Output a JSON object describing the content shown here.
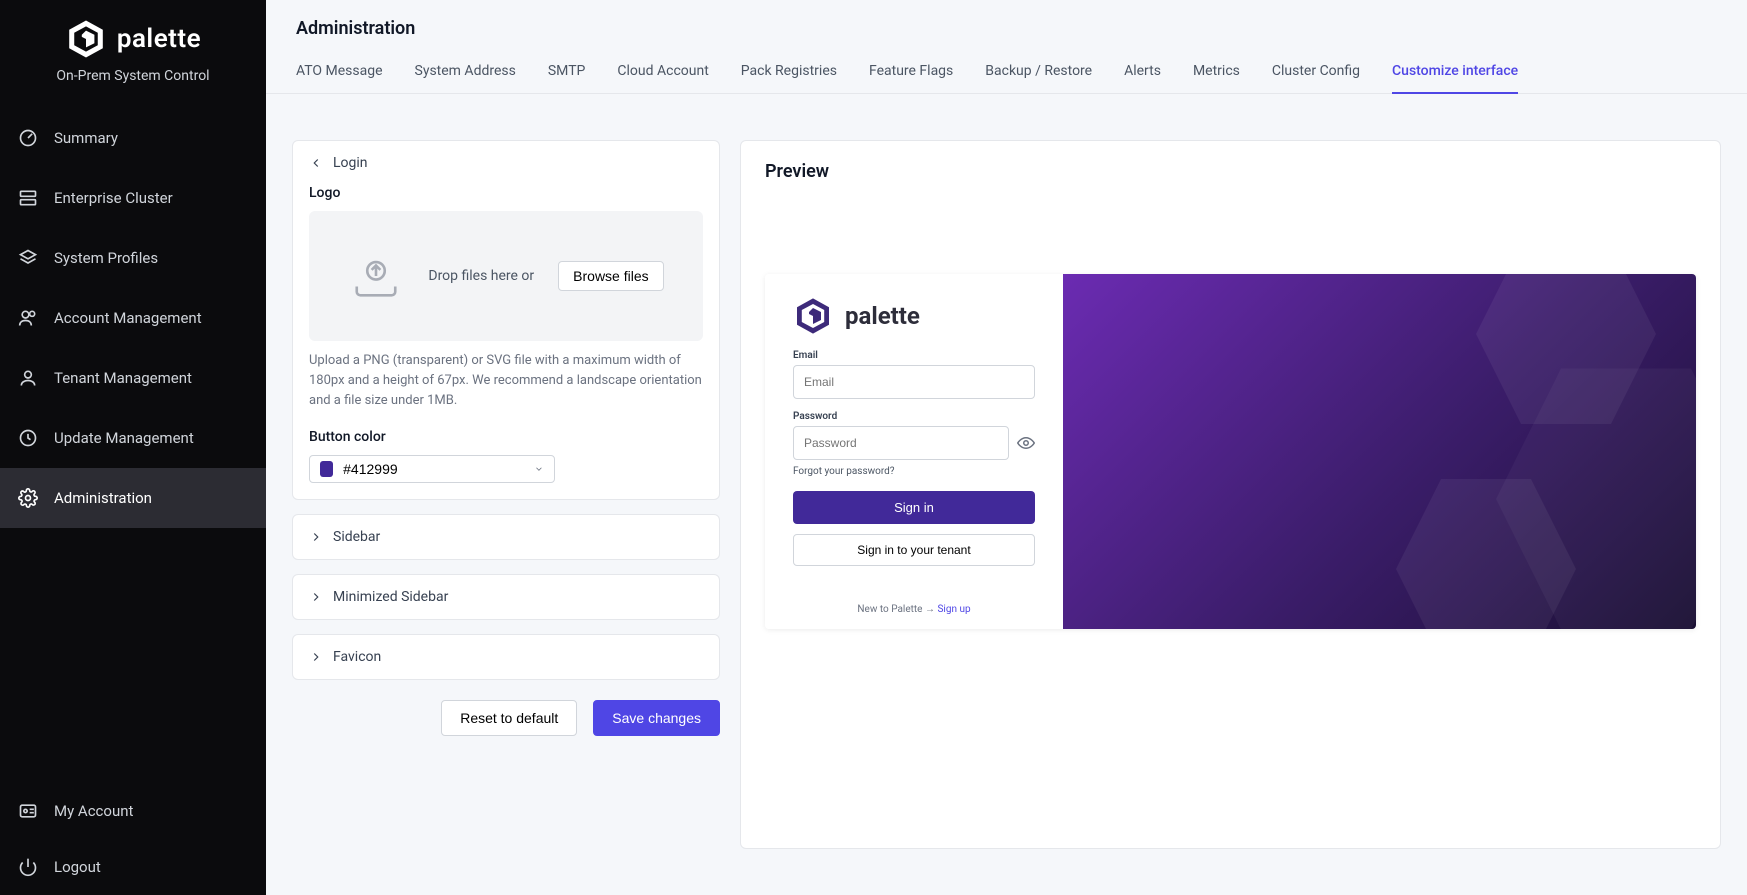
{
  "brand": {
    "product_name": "palette",
    "subtitle": "On-Prem System Control"
  },
  "sidebar": {
    "items": [
      {
        "label": "Summary"
      },
      {
        "label": "Enterprise Cluster"
      },
      {
        "label": "System Profiles"
      },
      {
        "label": "Account Management"
      },
      {
        "label": "Tenant Management"
      },
      {
        "label": "Update Management"
      },
      {
        "label": "Administration"
      }
    ],
    "footer": {
      "my_account": "My Account",
      "logout": "Logout"
    }
  },
  "header": {
    "title": "Administration"
  },
  "tabs": [
    {
      "label": "ATO Message"
    },
    {
      "label": "System Address"
    },
    {
      "label": "SMTP"
    },
    {
      "label": "Cloud Account"
    },
    {
      "label": "Pack Registries"
    },
    {
      "label": "Feature Flags"
    },
    {
      "label": "Backup / Restore"
    },
    {
      "label": "Alerts"
    },
    {
      "label": "Metrics"
    },
    {
      "label": "Cluster Config"
    },
    {
      "label": "Customize interface"
    }
  ],
  "customize": {
    "panels": {
      "login": {
        "title": "Login",
        "logo_label": "Logo",
        "drop_text": "Drop files here or",
        "browse_label": "Browse files",
        "logo_help": "Upload a PNG (transparent) or SVG file with a maximum width of 180px and a height of 67px. We recommend a landscape orientation and a file size under 1MB.",
        "button_color_label": "Button color",
        "button_color_value": "#412999"
      },
      "sidebar": {
        "title": "Sidebar"
      },
      "minimized_sidebar": {
        "title": "Minimized Sidebar"
      },
      "favicon": {
        "title": "Favicon"
      }
    },
    "actions": {
      "reset": "Reset to default",
      "save": "Save changes"
    }
  },
  "preview": {
    "title": "Preview",
    "brand_name": "palette",
    "email_label": "Email",
    "email_placeholder": "Email",
    "password_label": "Password",
    "password_placeholder": "Password",
    "forgot": "Forgot your password?",
    "sign_in": "Sign in",
    "tenant_sign_in": "Sign in to your tenant",
    "new_to": "New to Palette",
    "sign_up": "Sign up"
  },
  "colors": {
    "accent": "#4f46e5",
    "button": "#412999"
  }
}
